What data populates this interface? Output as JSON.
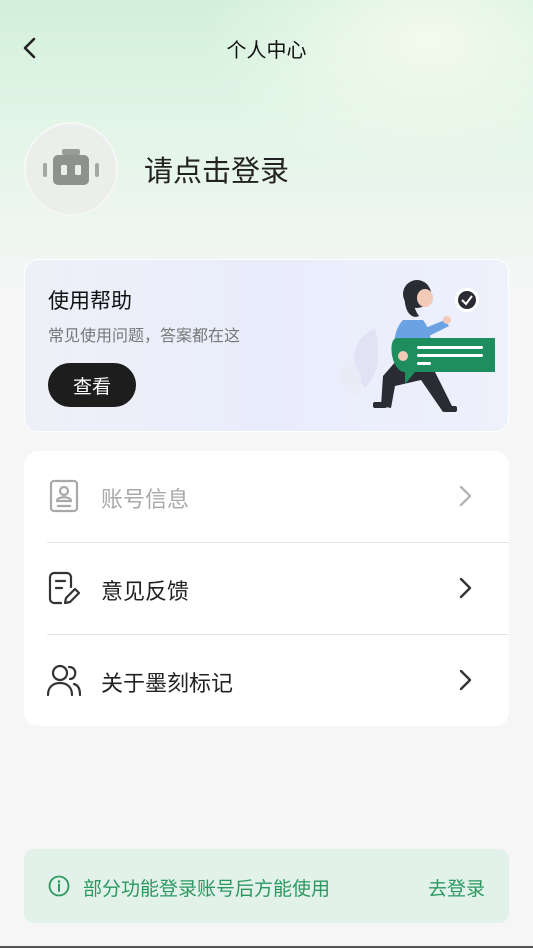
{
  "header": {
    "title": "个人中心",
    "back_icon": "chevron-left-icon"
  },
  "profile": {
    "avatar_icon": "robot-avatar-icon",
    "login_text": "请点击登录"
  },
  "help_card": {
    "title": "使用帮助",
    "subtitle": "常见使用问题，答案都在这",
    "button_label": "查看",
    "illustration": "woman-with-chat-bubble-illustration"
  },
  "menu": {
    "items": [
      {
        "label": "账号信息",
        "icon": "id-card-icon",
        "disabled": true
      },
      {
        "label": "意见反馈",
        "icon": "feedback-edit-icon",
        "disabled": false
      },
      {
        "label": "关于墨刻标记",
        "icon": "users-icon",
        "disabled": false
      }
    ]
  },
  "notice": {
    "icon": "info-icon",
    "text": "部分功能登录账号后方能使用",
    "link_label": "去登录"
  },
  "colors": {
    "accent_green": "#2b9860",
    "notice_bg": "#e2f2ea",
    "dark_button": "#1d1d1d",
    "header_gradient": "#d3f0dc"
  }
}
